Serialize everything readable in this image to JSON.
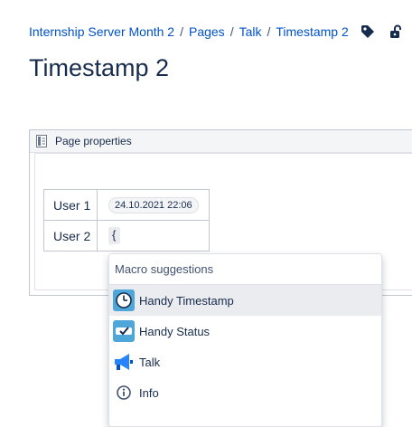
{
  "breadcrumb": {
    "items": [
      "Internship Server Month 2",
      "Pages",
      "Talk",
      "Timestamp 2"
    ],
    "separator": "/"
  },
  "header": {
    "icons": [
      "label-icon",
      "unlock-icon"
    ],
    "title": "Timestamp 2"
  },
  "macro": {
    "title": "Page properties",
    "icon": "page-properties-icon"
  },
  "properties": {
    "rows": [
      {
        "key": "User 1",
        "value": "24.10.2021 22:06"
      },
      {
        "key": "User 2",
        "value": "{"
      }
    ]
  },
  "suggestions": {
    "title": "Macro suggestions",
    "items": [
      {
        "label": "Handy Timestamp",
        "icon": "clock-icon",
        "active": true
      },
      {
        "label": "Handy Status",
        "icon": "status-icon",
        "active": false
      },
      {
        "label": "Talk",
        "icon": "megaphone-icon",
        "active": false
      },
      {
        "label": "Info",
        "icon": "info-icon",
        "active": false
      }
    ]
  },
  "colors": {
    "link": "#0052cc",
    "text": "#172b4d",
    "highlight": "#ebecf0"
  }
}
